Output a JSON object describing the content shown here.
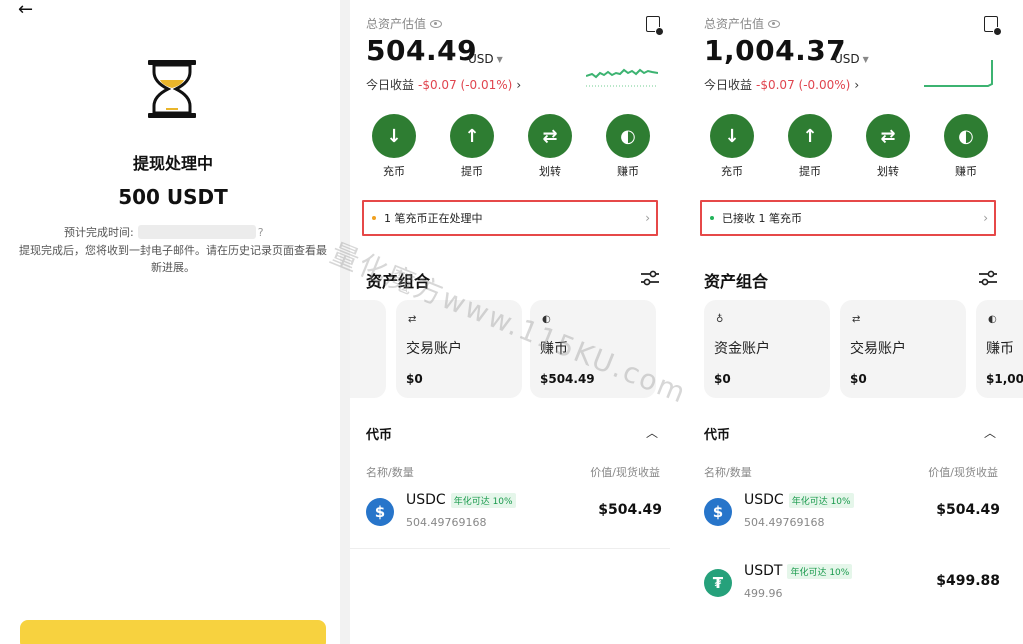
{
  "left": {
    "back_icon": "back-arrow-icon",
    "hourglass_icon": "hourglass-icon",
    "title": "提现处理中",
    "amount": "500 USDT",
    "eta_label": "预计完成时间:",
    "eta_tail": "?",
    "description": "提现完成后，您将收到一封电子邮件。请在历史记录页面查看最新进展。"
  },
  "panel1": {
    "total_label": "总资产估值",
    "balance": "504.49",
    "currency": "USD",
    "pnl_label": "今日收益",
    "pnl_value": "-$0.07 (-0.01%)",
    "actions": [
      {
        "label": "充币",
        "icon": "deposit-icon",
        "glyph": "↓"
      },
      {
        "label": "提币",
        "icon": "withdraw-icon",
        "glyph": "↑"
      },
      {
        "label": "划转",
        "icon": "transfer-icon",
        "glyph": "⇄"
      },
      {
        "label": "赚币",
        "icon": "earn-icon",
        "glyph": "◐"
      }
    ],
    "notice": "1 笔充币正在处理中",
    "notice_dot_color": "#f0a020",
    "section_title": "资产组合",
    "cards": [
      {
        "icon": "⇄",
        "name": "交易账户",
        "value": "$0"
      },
      {
        "icon": "◐",
        "name": "赚币",
        "value": "$504.49"
      }
    ],
    "tokens_title": "代币",
    "col_left": "名称/数量",
    "col_right": "价值/现货收益",
    "tokens": [
      {
        "name": "USDC",
        "badge": "年化可达 10%",
        "qty": "504.49769168",
        "value": "$504.49",
        "icon_color": "#2775ca",
        "glyph": "$"
      }
    ]
  },
  "panel2": {
    "total_label": "总资产估值",
    "balance": "1,004.37",
    "currency": "USD",
    "pnl_label": "今日收益",
    "pnl_value": "-$0.07 (-0.00%)",
    "actions": [
      {
        "label": "充币",
        "icon": "deposit-icon",
        "glyph": "↓"
      },
      {
        "label": "提币",
        "icon": "withdraw-icon",
        "glyph": "↑"
      },
      {
        "label": "划转",
        "icon": "transfer-icon",
        "glyph": "⇄"
      },
      {
        "label": "赚币",
        "icon": "earn-icon",
        "glyph": "◐"
      }
    ],
    "notice": "已接收 1 笔充币",
    "notice_dot_color": "#22b35a",
    "section_title": "资产组合",
    "cards": [
      {
        "icon": "♁",
        "name": "资金账户",
        "value": "$0"
      },
      {
        "icon": "⇄",
        "name": "交易账户",
        "value": "$0"
      },
      {
        "icon": "◐",
        "name": "赚币",
        "value": "$1,00"
      }
    ],
    "tokens_title": "代币",
    "col_left": "名称/数量",
    "col_right": "价值/现货收益",
    "tokens": [
      {
        "name": "USDC",
        "badge": "年化可达 10%",
        "qty": "504.49769168",
        "value": "$504.49",
        "icon_color": "#2775ca",
        "glyph": "$"
      },
      {
        "name": "USDT",
        "badge": "年化可达 10%",
        "qty": "499.96",
        "value": "$499.88",
        "icon_color": "#26a17b",
        "glyph": "₮"
      }
    ]
  },
  "watermark": "量化魔方www.115KU.com",
  "colors": {
    "accent_green": "#2e7d32",
    "negative": "#e0454f",
    "highlight_border": "#e64848",
    "yellow": "#f7d23f"
  }
}
